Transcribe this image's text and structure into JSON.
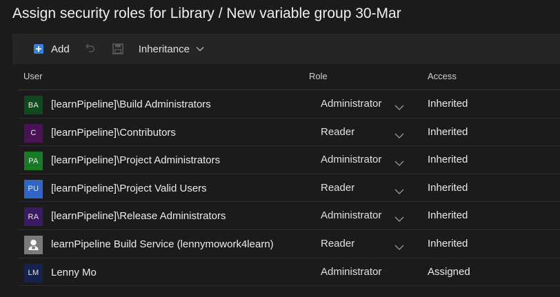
{
  "page": {
    "title": "Assign security roles for Library / New variable group 30-Mar"
  },
  "toolbar": {
    "add_label": "Add",
    "add_icon": "plus-square-icon",
    "undo_icon": "undo-icon",
    "save_icon": "save-icon",
    "inheritance_label": "Inheritance"
  },
  "columns": {
    "user": "User",
    "role": "Role",
    "access": "Access"
  },
  "colors": {
    "accent": "#3a7de0",
    "background": "#1b1b1b",
    "toolbar": "#252525"
  },
  "rows": [
    {
      "initials": "BA",
      "avatar_color": "#0e4a1c",
      "name": "[learnPipeline]\\Build Administrators",
      "role": "Administrator",
      "role_editable": true,
      "access": "Inherited"
    },
    {
      "initials": "C",
      "avatar_color": "#4b1255",
      "name": "[learnPipeline]\\Contributors",
      "role": "Reader",
      "role_editable": true,
      "access": "Inherited"
    },
    {
      "initials": "PA",
      "avatar_color": "#177a24",
      "name": "[learnPipeline]\\Project Administrators",
      "role": "Administrator",
      "role_editable": true,
      "access": "Inherited"
    },
    {
      "initials": "PU",
      "avatar_color": "#2f66c8",
      "name": "[learnPipeline]\\Project Valid Users",
      "role": "Reader",
      "role_editable": true,
      "access": "Inherited"
    },
    {
      "initials": "RA",
      "avatar_color": "#3b1a64",
      "name": "[learnPipeline]\\Release Administrators",
      "role": "Administrator",
      "role_editable": true,
      "access": "Inherited"
    },
    {
      "initials": "",
      "avatar_color": "#7a7a7a",
      "avatar_icon": "person-icon",
      "name": "learnPipeline Build Service (lennymowork4learn)",
      "role": "Reader",
      "role_editable": true,
      "access": "Inherited"
    },
    {
      "initials": "LM",
      "avatar_color": "#15224f",
      "name": "Lenny Mo",
      "role": "Administrator",
      "role_editable": false,
      "access": "Assigned"
    }
  ]
}
